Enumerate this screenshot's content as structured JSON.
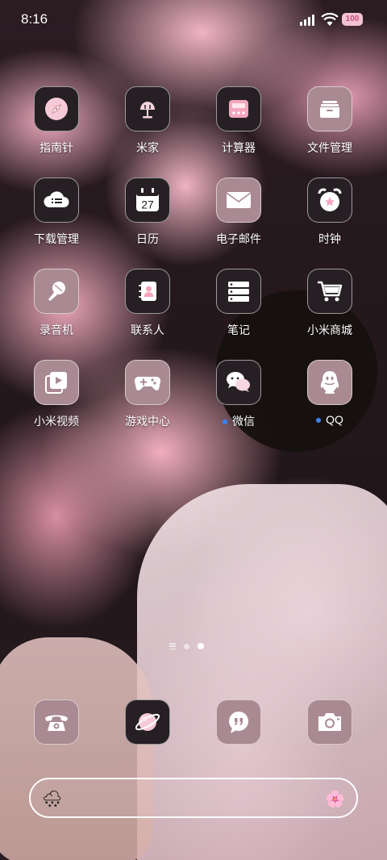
{
  "status_bar": {
    "time": "8:16",
    "battery": "100"
  },
  "apps": [
    {
      "name": "app-compass",
      "label": "指南针",
      "icon": "compass-icon",
      "style": "dark"
    },
    {
      "name": "app-mijia",
      "label": "米家",
      "icon": "mijia-lamp-icon",
      "style": "dark"
    },
    {
      "name": "app-calculator",
      "label": "计算器",
      "icon": "calculator-icon",
      "style": "dark"
    },
    {
      "name": "app-file-manager",
      "label": "文件管理",
      "icon": "folder-stack-icon",
      "style": "rose"
    },
    {
      "name": "app-download-manager",
      "label": "下载管理",
      "icon": "cloud-download-icon",
      "style": "dark"
    },
    {
      "name": "app-calendar",
      "label": "日历",
      "icon": "calendar-icon",
      "style": "dark",
      "date": "27"
    },
    {
      "name": "app-email",
      "label": "电子邮件",
      "icon": "envelope-icon",
      "style": "rose"
    },
    {
      "name": "app-clock",
      "label": "时钟",
      "icon": "alarm-clock-icon",
      "style": "dark"
    },
    {
      "name": "app-recorder",
      "label": "录音机",
      "icon": "microphone-icon",
      "style": "rose"
    },
    {
      "name": "app-contacts",
      "label": "联系人",
      "icon": "contacts-book-icon",
      "style": "dark"
    },
    {
      "name": "app-notes",
      "label": "笔记",
      "icon": "notes-list-icon",
      "style": "dark"
    },
    {
      "name": "app-mi-store",
      "label": "小米商城",
      "icon": "shopping-cart-icon",
      "style": "dark"
    },
    {
      "name": "app-mi-video",
      "label": "小米视频",
      "icon": "video-play-icon",
      "style": "rose"
    },
    {
      "name": "app-game-center",
      "label": "游戏中心",
      "icon": "gamepad-icon",
      "style": "rose"
    },
    {
      "name": "app-wechat",
      "label": "微信",
      "icon": "wechat-icon",
      "style": "dark",
      "badge_dot": true
    },
    {
      "name": "app-qq",
      "label": "QQ",
      "icon": "qq-penguin-icon",
      "style": "rose",
      "badge_dot": true
    }
  ],
  "dock": [
    {
      "name": "dock-phone",
      "icon": "telephone-icon",
      "style": "rose"
    },
    {
      "name": "dock-browser",
      "icon": "planet-browser-icon",
      "style": "dark"
    },
    {
      "name": "dock-messages",
      "icon": "message-bubble-icon",
      "style": "rose"
    },
    {
      "name": "dock-camera",
      "icon": "camera-icon",
      "style": "rose"
    }
  ],
  "pager": {
    "pages": 2,
    "current": 2
  },
  "search_bar": {
    "left_icon": "weather-cloud-icon",
    "right_icon": "flower-icon"
  },
  "colors": {
    "badge_dot": "#3b82f6",
    "battery_bg": "#f3c2d2",
    "icon_dark": "#262024",
    "icon_rose": "#a98a92"
  }
}
